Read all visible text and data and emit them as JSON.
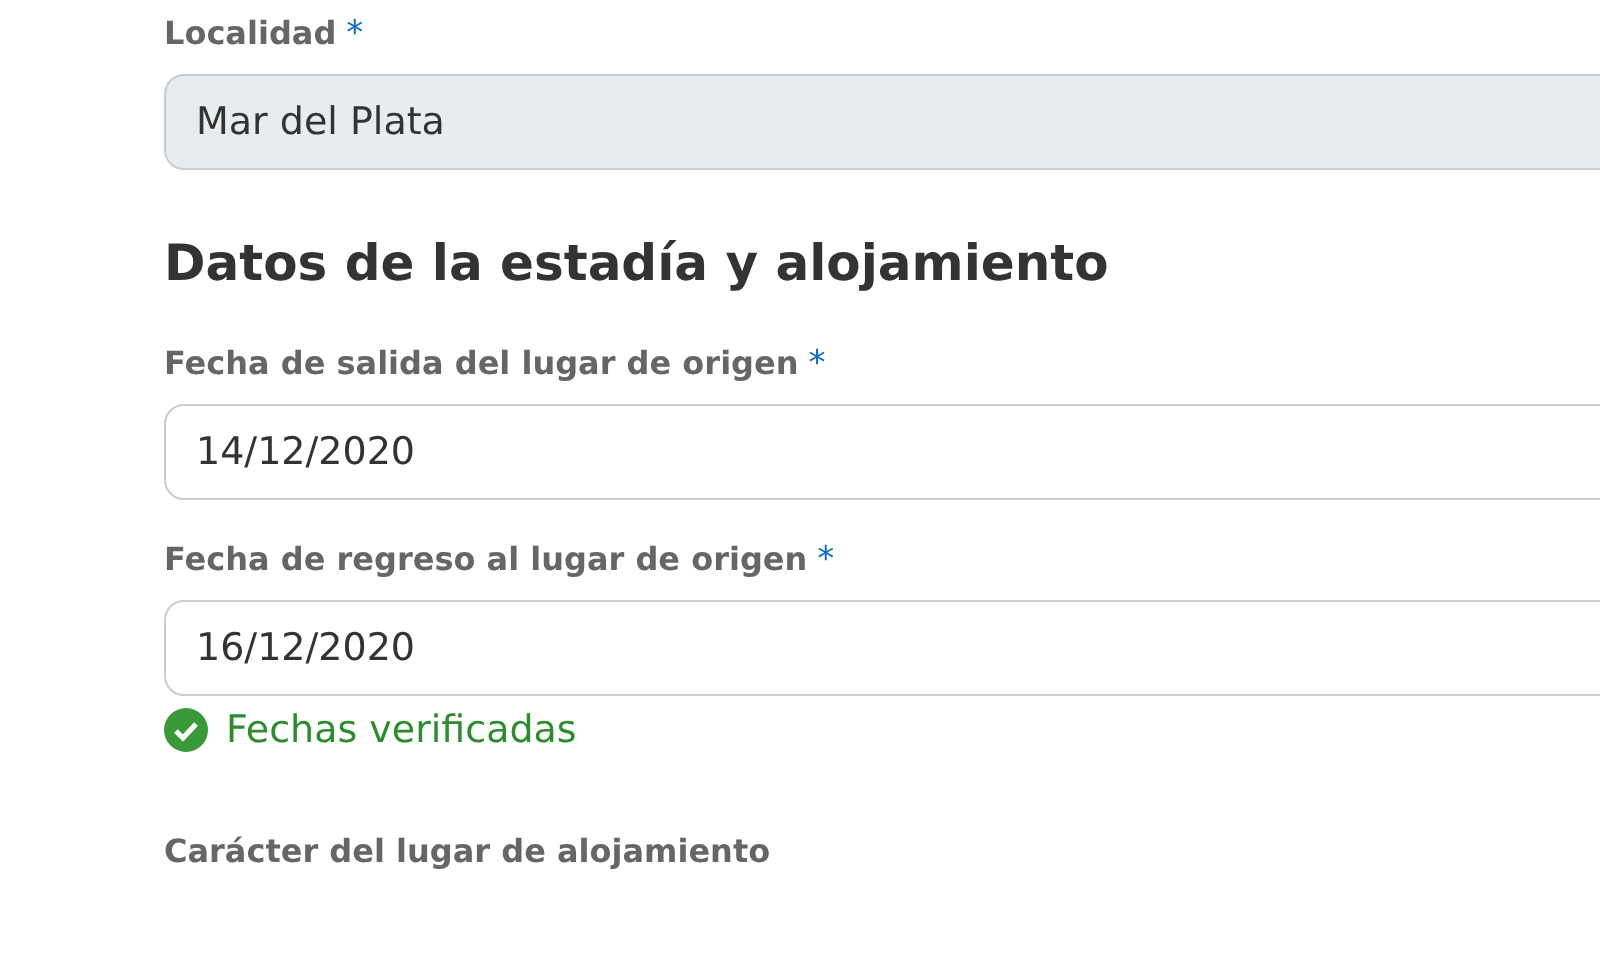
{
  "fields": [
    {
      "label": "Localidad",
      "required_mark": "*",
      "value": "Mar del Plata",
      "disabled": true
    },
    {
      "kind": "heading",
      "text": "Datos de la estadía y alojamiento"
    },
    {
      "label": "Fecha de salida del lugar de origen",
      "required_mark": "*",
      "value": "14/12/2020",
      "disabled": false
    },
    {
      "label": "Fecha de regreso al lugar de origen",
      "required_mark": "*",
      "value": "16/12/2020",
      "disabled": false,
      "validation": {
        "text": "Fechas verificadas",
        "valid": true
      }
    },
    {
      "kind": "label_only",
      "label": "Carácter del lugar de alojamiento"
    }
  ]
}
